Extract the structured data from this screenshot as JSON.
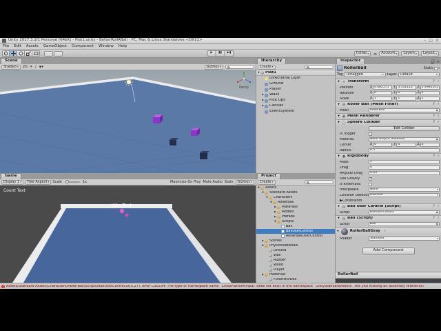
{
  "window": {
    "title": "Unity 2017.3.1f1 Personal (64bit) - Plat1.unity - BetterRollABall - PC, Mac & Linux Standalone <DX11>",
    "menus": [
      "File",
      "Edit",
      "Assets",
      "GameObject",
      "Component",
      "Window",
      "Help"
    ],
    "controls": {
      "minimize": "–",
      "maximize": "□",
      "close": "×"
    }
  },
  "toolbar": {
    "collab_label": "Collab",
    "account_label": "Account",
    "layers_label": "Layers",
    "layout_label": "Layout"
  },
  "scene": {
    "tab": "Scene",
    "shaded_label": "Shaded",
    "mode_2d_label": "2D",
    "gizmos_label": "Gizmos",
    "persp_label": "Persp"
  },
  "game": {
    "tab": "Game",
    "display_label": "Display 1",
    "aspect_label": "Free Aspect",
    "scale_label": "Scale",
    "scale_value": "1x",
    "maximize_label": "Maximize On Play",
    "mute_label": "Mute Audio",
    "stats_label": "Stats",
    "gizmos_label": "Gizmos",
    "count_text": "Count Text",
    "win_text": "Win Text"
  },
  "hierarchy": {
    "tab": "Hierarchy",
    "create_label": "Create",
    "items": [
      {
        "label": "Plat1",
        "indent": 0,
        "scene": true,
        "arrow": "open",
        "icon": "mat"
      },
      {
        "label": "Directional Light",
        "indent": 1,
        "icon": "light"
      },
      {
        "label": "Ground",
        "indent": 1,
        "icon": "go"
      },
      {
        "label": "Player",
        "indent": 1,
        "icon": "go"
      },
      {
        "label": "Walls",
        "indent": 1,
        "arrow": "closed",
        "icon": "go"
      },
      {
        "label": "Pick Ups",
        "indent": 1,
        "arrow": "closed",
        "icon": "go"
      },
      {
        "label": "Canvas",
        "indent": 1,
        "arrow": "closed",
        "icon": "go"
      },
      {
        "label": "EventSystem",
        "indent": 1,
        "icon": "go"
      }
    ]
  },
  "project": {
    "tab": "Project",
    "create_label": "Create",
    "items": [
      {
        "label": "Assets",
        "indent": 0,
        "icon": "folder",
        "arrow": "open"
      },
      {
        "label": "Standard Assets",
        "indent": 1,
        "icon": "folder",
        "arrow": "open"
      },
      {
        "label": "Characters",
        "indent": 2,
        "icon": "folder",
        "arrow": "open"
      },
      {
        "label": "RollerBall",
        "indent": 3,
        "icon": "folder",
        "arrow": "open"
      },
      {
        "label": "Materials",
        "indent": 4,
        "icon": "folder",
        "arrow": "closed"
      },
      {
        "label": "Models",
        "indent": 4,
        "icon": "folder",
        "arrow": "closed"
      },
      {
        "label": "Prefabs",
        "indent": 4,
        "icon": "folder",
        "arrow": "closed"
      },
      {
        "label": "Scripts",
        "indent": 4,
        "icon": "folder",
        "arrow": "open"
      },
      {
        "label": "Ball",
        "indent": 5,
        "icon": "script"
      },
      {
        "label": "BallUserControl",
        "indent": 5,
        "icon": "script",
        "selected": true
      },
      {
        "label": "RollerBallUserControl",
        "indent": 5,
        "icon": "script"
      },
      {
        "label": "Scenes",
        "indent": 1,
        "icon": "folder",
        "arrow": "closed"
      },
      {
        "label": "PhysicsMaterials",
        "indent": 1,
        "icon": "folder",
        "arrow": "open"
      },
      {
        "label": "Ground",
        "indent": 2,
        "icon": "mat"
      },
      {
        "label": "Wall",
        "indent": 2,
        "icon": "mat"
      },
      {
        "label": "Rubber",
        "indent": 2,
        "icon": "mat"
      },
      {
        "label": "Wood",
        "indent": 2,
        "icon": "mat"
      },
      {
        "label": "Player",
        "indent": 2,
        "icon": "mat"
      },
      {
        "label": "materials",
        "indent": 1,
        "icon": "folder",
        "arrow": "closed"
      },
      {
        "label": "FuturisticWall",
        "indent": 2,
        "icon": "mat"
      }
    ]
  },
  "inspector": {
    "tab": "Inspector",
    "object_name": "RollerBall",
    "static_label": "Static",
    "tag_label": "Tag",
    "tag_value": "Untagged",
    "layer_label": "Layer",
    "layer_value": "Default",
    "components": [
      {
        "name": "Transform",
        "glyph": "✛",
        "rows": [
          {
            "type": "vec3",
            "label": "Position",
            "x": "4.482571",
            "y": "3.332123",
            "z": "0.4992243"
          },
          {
            "type": "vec3",
            "label": "Rotation",
            "x": "0",
            "y": "0",
            "z": "0"
          },
          {
            "type": "vec3",
            "label": "Scale",
            "x": "1",
            "y": "1",
            "z": "1"
          }
        ]
      },
      {
        "name": "Roller Ball (Mesh Filter)",
        "glyph": "⊞",
        "rows": [
          {
            "type": "object",
            "label": "Mesh",
            "value": "RollerBall"
          }
        ]
      },
      {
        "name": "Mesh Renderer",
        "glyph": "▣",
        "rows": []
      },
      {
        "name": "Sphere Collider",
        "glyph": "◯",
        "rows": [
          {
            "type": "button",
            "label": "Edit Collider"
          },
          {
            "type": "check",
            "label": "Is Trigger",
            "checked": false
          },
          {
            "type": "object",
            "label": "Material",
            "value": "None (Physic Material)"
          },
          {
            "type": "vec3",
            "label": "Center",
            "x": "0",
            "y": "0",
            "z": "0"
          },
          {
            "type": "field",
            "label": "Radius",
            "value": "0.5"
          }
        ]
      },
      {
        "name": "Rigidbody",
        "glyph": "●",
        "rows": [
          {
            "type": "field",
            "label": "Mass",
            "value": "1"
          },
          {
            "type": "field",
            "label": "Drag",
            "value": "0"
          },
          {
            "type": "field",
            "label": "Angular Drag",
            "value": "0.05"
          },
          {
            "type": "check",
            "label": "Use Gravity",
            "checked": true
          },
          {
            "type": "check",
            "label": "Is Kinematic",
            "checked": false
          },
          {
            "type": "dropdown",
            "label": "Interpolate",
            "value": "None"
          },
          {
            "type": "dropdown",
            "label": "Collision Detection",
            "value": "Discrete"
          },
          {
            "type": "foldout",
            "label": "Constraints"
          }
        ]
      },
      {
        "name": "Ball User Control (Script)",
        "glyph": "▤",
        "rows": [
          {
            "type": "object",
            "label": "Script",
            "value": "BallUserControl"
          }
        ]
      },
      {
        "name": "Ball (Script)",
        "glyph": "▤",
        "rows": [
          {
            "type": "object",
            "label": "Script",
            "value": "Ball"
          }
        ]
      }
    ],
    "material": {
      "name": "RollerBallGray",
      "shader_label": "Shader",
      "shader_value": "Standard"
    },
    "add_component_label": "Add Component",
    "preview_label": "RollerBall"
  },
  "status": {
    "error": "Assets/Standard Assets/Characters/RollerBall/Scripts/BallUserControl.cs(5,27): error CS0234: The type or namespace name `CrossPlatformInput' does not exist in the namespace `UnityStandardAssets'. Are you missing an assembly reference?"
  }
}
